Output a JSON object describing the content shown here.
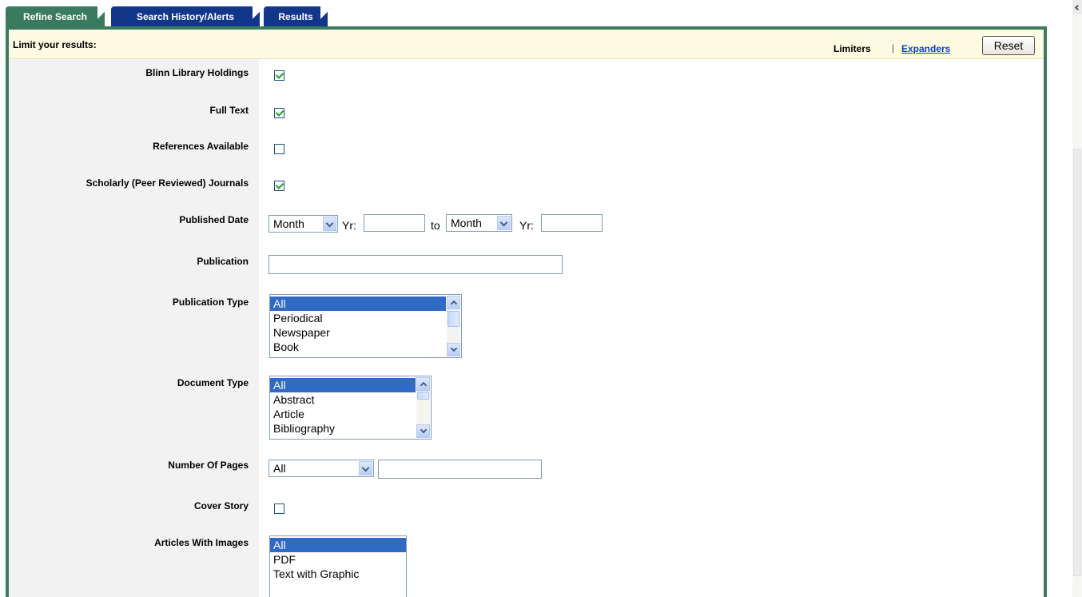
{
  "tabs": [
    {
      "label": "Refine Search",
      "active": true
    },
    {
      "label": "Search History/Alerts",
      "active": false
    },
    {
      "label": "Results",
      "active": false
    }
  ],
  "header": {
    "limit_label": "Limit your results:",
    "limiters_label": "Limiters",
    "separator": "|",
    "expanders_label": "Expanders",
    "reset_label": "Reset"
  },
  "fields": {
    "blinn_library_holdings": {
      "label": "Blinn Library Holdings",
      "checked": true
    },
    "full_text": {
      "label": "Full Text",
      "checked": true
    },
    "references_available": {
      "label": "References Available",
      "checked": false
    },
    "scholarly_journals": {
      "label": "Scholarly (Peer Reviewed) Journals",
      "checked": true
    },
    "published_date": {
      "label": "Published Date",
      "from_month": "Month",
      "yr_label": "Yr:",
      "to_label": "to",
      "to_month": "Month",
      "to_yr_label": "Yr:",
      "from_year": "",
      "to_year": ""
    },
    "publication": {
      "label": "Publication",
      "value": ""
    },
    "publication_type": {
      "label": "Publication Type",
      "options": [
        "All",
        "Periodical",
        "Newspaper",
        "Book"
      ],
      "selected": "All"
    },
    "document_type": {
      "label": "Document Type",
      "options": [
        "All",
        "Abstract",
        "Article",
        "Bibliography"
      ],
      "selected": "All"
    },
    "number_of_pages": {
      "label": "Number Of Pages",
      "selected": "All",
      "value": ""
    },
    "cover_story": {
      "label": "Cover Story",
      "checked": false
    },
    "articles_with_images": {
      "label": "Articles With Images",
      "options": [
        "All",
        "PDF",
        "Text with Graphic"
      ],
      "selected": "All"
    }
  },
  "colors": {
    "active_tab": "#3a7a5e",
    "inactive_tab": "#12378a",
    "panel_border": "#3a7a5e",
    "header_bg": "#fdfbe1",
    "selection": "#316ac5",
    "link": "#0b44c2"
  }
}
